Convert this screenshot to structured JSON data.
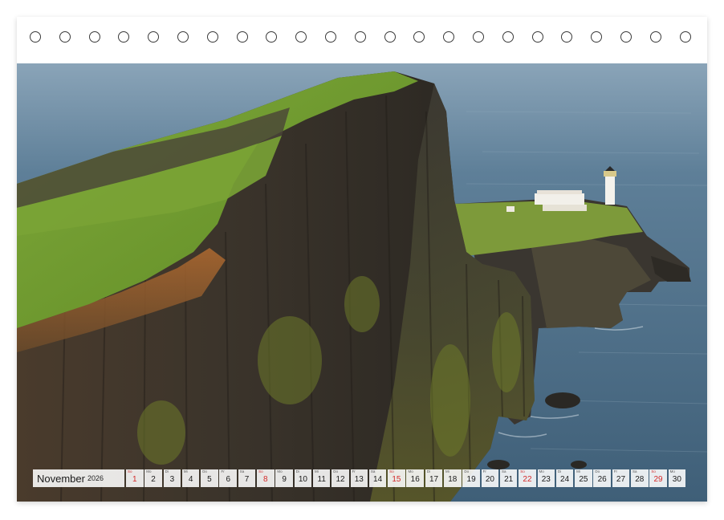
{
  "calendar": {
    "month": "November",
    "year": "2026",
    "days": [
      {
        "num": "1",
        "wd": "So",
        "sunday": true
      },
      {
        "num": "2",
        "wd": "Mo",
        "sunday": false
      },
      {
        "num": "3",
        "wd": "Di",
        "sunday": false
      },
      {
        "num": "4",
        "wd": "Mi",
        "sunday": false
      },
      {
        "num": "5",
        "wd": "Do",
        "sunday": false
      },
      {
        "num": "6",
        "wd": "Fr",
        "sunday": false
      },
      {
        "num": "7",
        "wd": "Sa",
        "sunday": false
      },
      {
        "num": "8",
        "wd": "So",
        "sunday": true
      },
      {
        "num": "9",
        "wd": "Mo",
        "sunday": false
      },
      {
        "num": "10",
        "wd": "Di",
        "sunday": false
      },
      {
        "num": "11",
        "wd": "Mi",
        "sunday": false
      },
      {
        "num": "12",
        "wd": "Do",
        "sunday": false
      },
      {
        "num": "13",
        "wd": "Fr",
        "sunday": false
      },
      {
        "num": "14",
        "wd": "Sa",
        "sunday": false
      },
      {
        "num": "15",
        "wd": "So",
        "sunday": true
      },
      {
        "num": "16",
        "wd": "Mo",
        "sunday": false
      },
      {
        "num": "17",
        "wd": "Di",
        "sunday": false
      },
      {
        "num": "18",
        "wd": "Mi",
        "sunday": false
      },
      {
        "num": "19",
        "wd": "Do",
        "sunday": false
      },
      {
        "num": "20",
        "wd": "Fr",
        "sunday": false
      },
      {
        "num": "21",
        "wd": "Sa",
        "sunday": false
      },
      {
        "num": "22",
        "wd": "So",
        "sunday": true
      },
      {
        "num": "23",
        "wd": "Mo",
        "sunday": false
      },
      {
        "num": "24",
        "wd": "Di",
        "sunday": false
      },
      {
        "num": "25",
        "wd": "Mi",
        "sunday": false
      },
      {
        "num": "26",
        "wd": "Do",
        "sunday": false
      },
      {
        "num": "27",
        "wd": "Fr",
        "sunday": false
      },
      {
        "num": "28",
        "wd": "Sa",
        "sunday": false
      },
      {
        "num": "29",
        "wd": "So",
        "sunday": true
      },
      {
        "num": "30",
        "wd": "Mo",
        "sunday": false
      }
    ]
  },
  "binding": {
    "ring_count": 23
  },
  "colors": {
    "sunday": "#d42a2a",
    "sea": "#50708a",
    "grass": "#6f9a2e",
    "rock": "#3a332a"
  }
}
